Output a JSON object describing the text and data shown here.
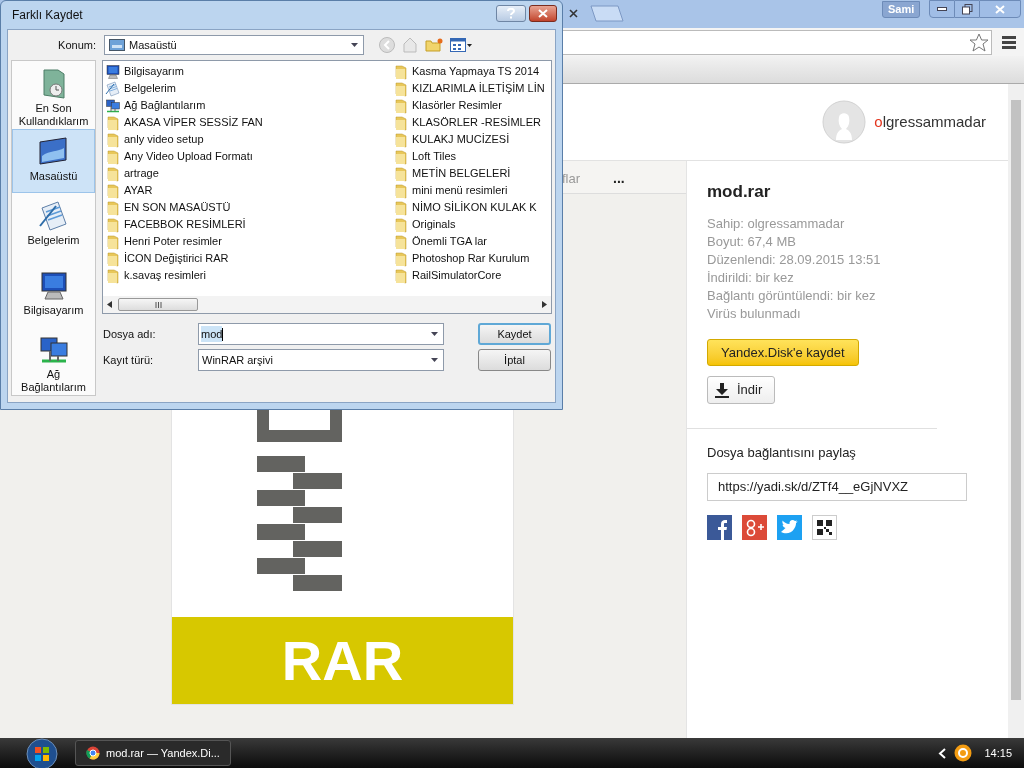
{
  "browser": {
    "user_badge": "Sami",
    "account": {
      "name": "olgressammadar"
    },
    "nav": {
      "partial_tab": "flar",
      "more": "..."
    },
    "file_preview": {
      "label": "RAR"
    },
    "file_panel": {
      "title": "mod.rar",
      "details": [
        "Sahip: olgressammadar",
        "Boyut: 67,4 MB",
        "Düzenlendi: 28.09.2015 13:51",
        "İndirildi: bir kez",
        "Bağlantı görüntülendi: bir kez",
        "Virüs bulunmadı"
      ],
      "save_button": "Yandex.Disk'e kaydet",
      "download_button": "İndir",
      "share_label": "Dosya bağlantısını paylaş",
      "share_link": "https://yadi.sk/d/ZTf4__eGjNVXZ"
    }
  },
  "dialog": {
    "title": "Farklı Kaydet",
    "location_label": "Konum:",
    "location": "Masaüstü",
    "places": [
      {
        "label": "En Son Kullandıklarım",
        "kind": "recent",
        "selected": false
      },
      {
        "label": "Masaüstü",
        "kind": "desktop",
        "selected": true
      },
      {
        "label": "Belgelerim",
        "kind": "documents",
        "selected": false
      },
      {
        "label": "Bilgisayarım",
        "kind": "computer",
        "selected": false
      },
      {
        "label": "Ağ Bağlantılarım",
        "kind": "network",
        "selected": false
      }
    ],
    "files": [
      {
        "name": "Bilgisayarım",
        "kind": "computer"
      },
      {
        "name": "Belgelerim",
        "kind": "documents"
      },
      {
        "name": "Ağ Bağlantılarım",
        "kind": "network"
      },
      {
        "name": "AKASA VİPER SESSİZ FAN",
        "kind": "folder"
      },
      {
        "name": "anly video setup",
        "kind": "folder"
      },
      {
        "name": "Any Video Upload Formatı",
        "kind": "folder"
      },
      {
        "name": "artrage",
        "kind": "folder"
      },
      {
        "name": "AYAR",
        "kind": "folder"
      },
      {
        "name": "EN SON MASAÜSTÜ",
        "kind": "folder"
      },
      {
        "name": "FACEBBOK RESİMLERİ",
        "kind": "folder"
      },
      {
        "name": "Henri Poter resimler",
        "kind": "folder"
      },
      {
        "name": "İCON Değiştirici RAR",
        "kind": "folder"
      },
      {
        "name": "k.savaş resimleri",
        "kind": "folder"
      },
      {
        "name": "Kasma Yapmaya TS 2014",
        "kind": "folder"
      },
      {
        "name": "KIZLARIMLA İLETİŞİM LİN",
        "kind": "folder"
      },
      {
        "name": "Klasörler Resimler",
        "kind": "folder"
      },
      {
        "name": "KLASÖRLER -RESİMLER",
        "kind": "folder"
      },
      {
        "name": "KULAKJ MUCİZESİ",
        "kind": "folder"
      },
      {
        "name": "Loft Tiles",
        "kind": "folder"
      },
      {
        "name": "METİN BELGELERİ",
        "kind": "folder"
      },
      {
        "name": "mini menü resimleri",
        "kind": "folder"
      },
      {
        "name": "NİMO SİLİKON KULAK K",
        "kind": "folder"
      },
      {
        "name": "Originals",
        "kind": "folder"
      },
      {
        "name": "Önemli TGA lar",
        "kind": "folder"
      },
      {
        "name": "Photoshop Rar Kurulum",
        "kind": "folder"
      },
      {
        "name": "RailSimulatorCore",
        "kind": "folder"
      }
    ],
    "filename_label": "Dosya adı:",
    "filename": "mod",
    "type_label": "Kayıt türü:",
    "type": "WinRAR arşivi",
    "buttons": [
      "Kaydet",
      "İptal"
    ]
  },
  "taskbar": {
    "tasks": [
      {
        "label": "mod.rar — Yandex.Di...",
        "selected": false
      }
    ],
    "clock": "14:15"
  }
}
